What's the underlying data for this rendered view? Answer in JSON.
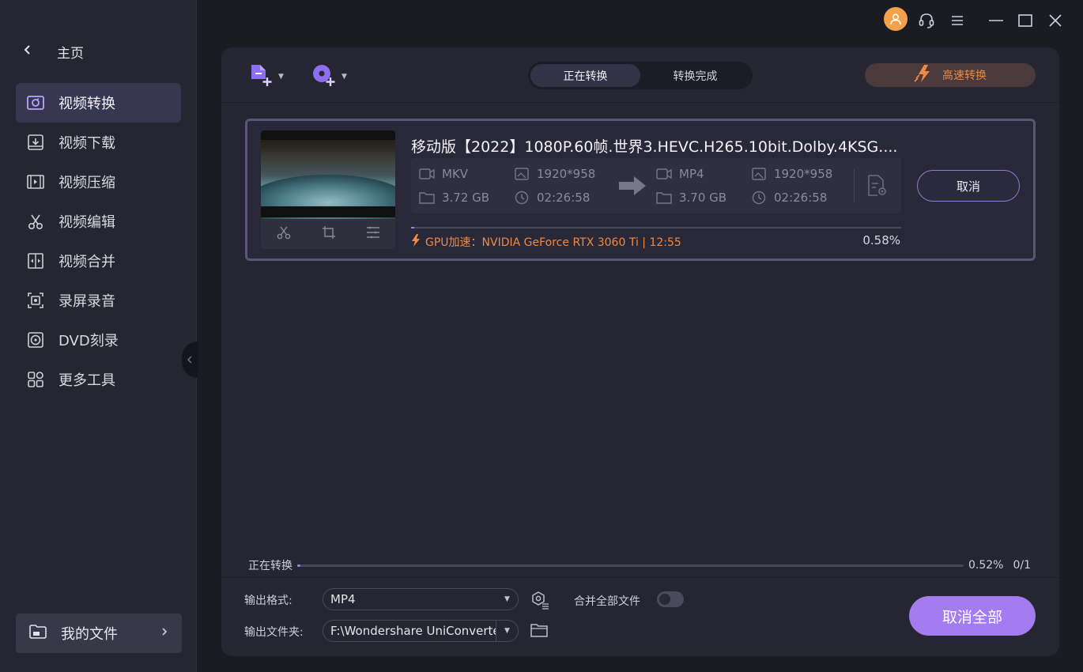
{
  "sidebar": {
    "home_label": "主页",
    "items": [
      {
        "label": "视频转换",
        "icon": "video-convert-icon",
        "active": true
      },
      {
        "label": "视频下载",
        "icon": "download-icon",
        "active": false
      },
      {
        "label": "视频压缩",
        "icon": "compress-icon",
        "active": false
      },
      {
        "label": "视频编辑",
        "icon": "scissors-icon",
        "active": false
      },
      {
        "label": "视频合并",
        "icon": "merge-icon",
        "active": false
      },
      {
        "label": "录屏录音",
        "icon": "screen-record-icon",
        "active": false
      },
      {
        "label": "DVD刻录",
        "icon": "dvd-icon",
        "active": false
      },
      {
        "label": "更多工具",
        "icon": "grid-icon",
        "active": false
      }
    ],
    "my_files_label": "我的文件"
  },
  "toolbar": {
    "tabs": [
      "正在转换",
      "转换完成"
    ],
    "active_tab": "正在转换",
    "fast_convert_label": "高速转换"
  },
  "task": {
    "title": "移动版【2022】1080P.60帧.世界3.HEVC.H265.10bit.Dolby.4KSG....",
    "source": {
      "format": "MKV",
      "resolution": "1920*958",
      "size": "3.72 GB",
      "duration": "02:26:58"
    },
    "target": {
      "format": "MP4",
      "resolution": "1920*958",
      "size": "3.70 GB",
      "duration": "02:26:58"
    },
    "cancel_label": "取消",
    "gpu_text": "GPU加速：NVIDIA GeForce RTX 3060 Ti | 12:55",
    "percent": "0.58%",
    "progress_fraction": 0.0058
  },
  "footer": {
    "converting_label": "正在转换",
    "overall_percent": "0.52%",
    "overall_fraction": 0.0052,
    "count": "0/1",
    "output_format_label": "输出格式:",
    "output_format_value": "MP4",
    "merge_label": "合并全部文件",
    "merge_enabled": false,
    "output_folder_label": "输出文件夹:",
    "output_folder_value": "F:\\Wondershare UniConverte",
    "cancel_all_label": "取消全部"
  },
  "colors": {
    "accent": "#9a7dff",
    "orange": "#f08a45",
    "cancel_all_bg": "#a47cf2"
  }
}
